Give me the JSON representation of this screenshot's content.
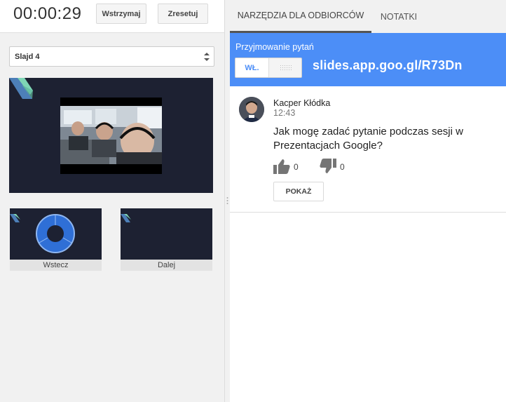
{
  "presenter": {
    "timer": "00:00:29",
    "pause_label": "Wstrzymaj",
    "reset_label": "Zresetuj",
    "slide_select": "Slajd 4",
    "prev_label": "Wstecz",
    "next_label": "Dalej"
  },
  "tabs": [
    {
      "label": "NARZĘDZIA DLA ODBIORCÓW",
      "active": true
    },
    {
      "label": "NOTATKI",
      "active": false
    }
  ],
  "qa": {
    "title": "Przyjmowanie pytań",
    "toggle_label": "WŁ.",
    "url": "slides.app.goo.gl/R73Dn"
  },
  "question": {
    "author": "Kacper Kłódka",
    "time": "12:43",
    "text": "Jak mogę zadać pytanie podczas sesji w Prezentacjach Google?",
    "upvotes": "0",
    "downvotes": "0",
    "show_label": "POKAŻ"
  },
  "colors": {
    "accent_blue": "#4c8ef7",
    "slide_bg": "#1d2132"
  }
}
